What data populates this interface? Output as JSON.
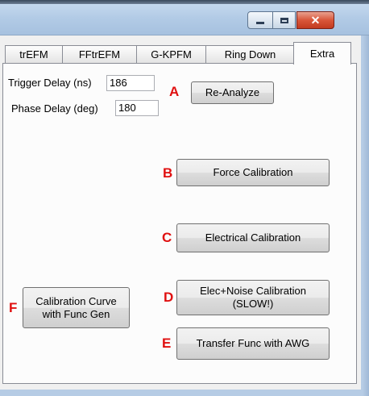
{
  "window": {
    "minimize_glyph": "minimize-icon",
    "maximize_glyph": "maximize-icon",
    "close_glyph": "✕"
  },
  "tabs": [
    {
      "label": "trEFM"
    },
    {
      "label": "FFtrEFM"
    },
    {
      "label": "G-KPFM"
    },
    {
      "label": "Ring Down"
    },
    {
      "label": "Extra",
      "active": true
    }
  ],
  "extra": {
    "trigger_delay_label": "Trigger Delay (ns)",
    "trigger_delay_value": "186",
    "phase_delay_label": "Phase Delay (deg)",
    "phase_delay_value": "180",
    "reanalyze_label": "Re-Analyze",
    "force_calibration_label": "Force Calibration",
    "electrical_calibration_label": "Electrical Calibration",
    "elec_noise_calibration_line1": "Elec+Noise Calibration",
    "elec_noise_calibration_line2": "(SLOW!)",
    "transfer_func_label": "Transfer Func with AWG",
    "calibration_curve_line1": "Calibration Curve",
    "calibration_curve_line2": "with Func Gen"
  },
  "markers": {
    "a": "A",
    "b": "B",
    "c": "C",
    "d": "D",
    "e": "E",
    "f": "F"
  },
  "colors": {
    "marker": "#e01010",
    "close_button": "#c9452a",
    "titlebar": "#b2cbe6"
  }
}
